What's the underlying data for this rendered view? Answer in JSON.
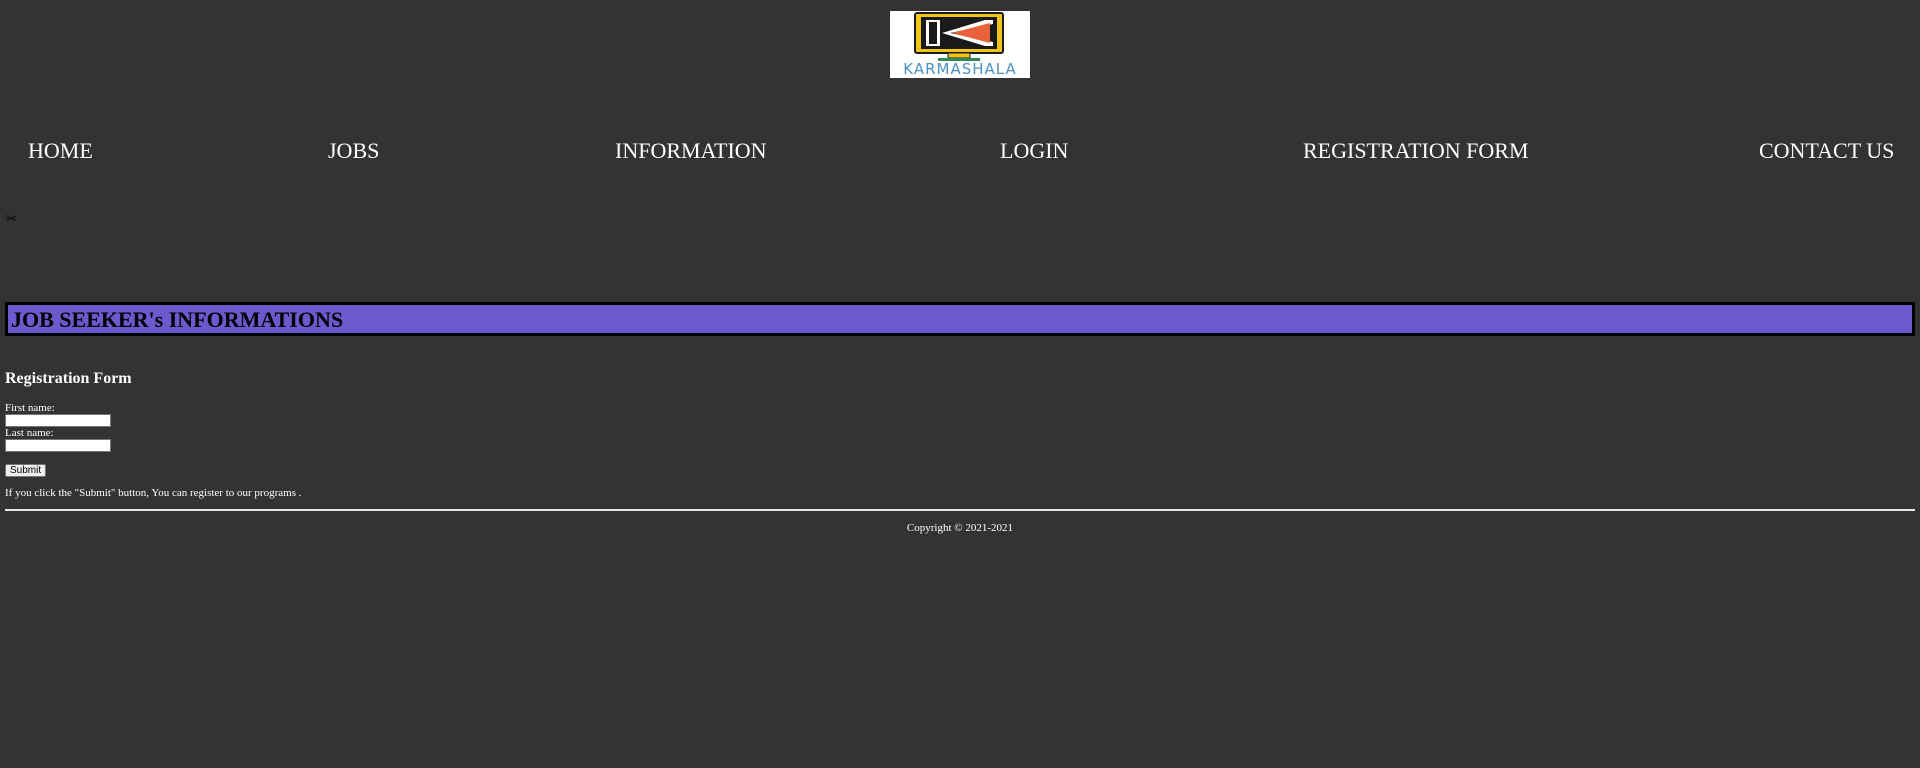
{
  "header": {
    "logo_text": "KARMASHALA"
  },
  "nav": {
    "items": [
      {
        "label": "HOME"
      },
      {
        "label": "JOBS"
      },
      {
        "label": "INFORMATION"
      },
      {
        "label": "LOGIN"
      },
      {
        "label": "REGISTRATION FORM"
      },
      {
        "label": "CONTACT US"
      }
    ]
  },
  "broken_image": {
    "icon": "broken-image-icon",
    "glyph": "✂"
  },
  "banner": {
    "title": "JOB SEEKER's INFORMATIONS",
    "color": "#6a5acd"
  },
  "form": {
    "title": "Registration Form",
    "first_name_label": "First name:",
    "first_name_value": "",
    "last_name_label": "Last name:",
    "last_name_value": "",
    "submit_label": "Submit",
    "note": "If you click the \"Submit\" button, You can register to our programs ."
  },
  "footer": {
    "copyright": "Copyright © 2021-2021"
  }
}
